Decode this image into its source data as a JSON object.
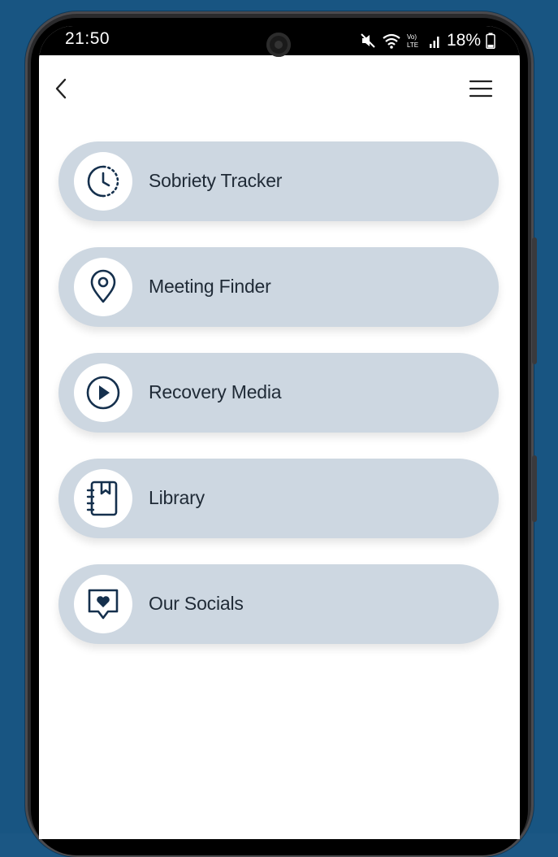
{
  "status_bar": {
    "time": "21:50",
    "battery_percent": "18%",
    "network_label": "Vo) LTE",
    "icons": [
      "mute-icon",
      "wifi-icon",
      "volte-icon",
      "signal-icon",
      "battery-icon"
    ]
  },
  "header": {
    "back_icon": "chevron-left-icon",
    "menu_icon": "hamburger-menu-icon"
  },
  "menu": {
    "items": [
      {
        "label": "Sobriety Tracker",
        "icon": "clock-icon"
      },
      {
        "label": "Meeting Finder",
        "icon": "location-pin-icon"
      },
      {
        "label": "Recovery Media",
        "icon": "play-circle-icon"
      },
      {
        "label": "Library",
        "icon": "notebook-bookmark-icon"
      },
      {
        "label": "Our Socials",
        "icon": "chat-heart-icon"
      }
    ]
  },
  "colors": {
    "background": "#185582",
    "card": "#cdd7e1",
    "icon": "#15304d",
    "text": "#1f2a36"
  }
}
